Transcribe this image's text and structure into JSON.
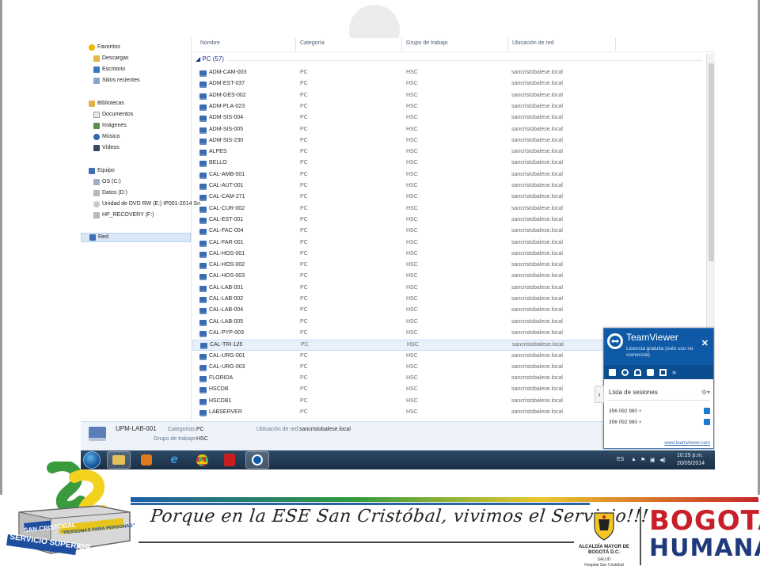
{
  "nav": {
    "favorites": "Favoritos",
    "downloads": "Descargas",
    "desktop": "Escritorio",
    "recent": "Sitios recientes",
    "libraries": "Bibliotecas",
    "documents": "Documentos",
    "images": "Imágenes",
    "music": "Música",
    "videos": "Vídeos",
    "computer": "Equipo",
    "drive_c": "OS (C:)",
    "drive_d": "Datos (D:)",
    "drive_e": "Unidad de DVD RW (E:) IP001-2014 Sn",
    "drive_f": "HP_RECOVERY (F:)",
    "network": "Red"
  },
  "columns": {
    "name": "Nombre",
    "category": "Categoría",
    "workgroup": "Grupo de trabajo",
    "location": "Ubicación de red"
  },
  "group_header": "PC (57)",
  "rows": [
    {
      "name": "ADM-CAM-003",
      "category": "PC",
      "group": "HSC",
      "location": "sancristobalese.local"
    },
    {
      "name": "ADM-EST-037",
      "category": "PC",
      "group": "HSC",
      "location": "sancristobalese.local"
    },
    {
      "name": "ADM-GES-002",
      "category": "PC",
      "group": "HSC",
      "location": "sancristobalese.local"
    },
    {
      "name": "ADM-PLA-023",
      "category": "PC",
      "group": "HSC",
      "location": "sancristobalese.local"
    },
    {
      "name": "ADM-SIS-004",
      "category": "PC",
      "group": "HSC",
      "location": "sancristobalese.local"
    },
    {
      "name": "ADM-SIS-005",
      "category": "PC",
      "group": "HSC",
      "location": "sancristobalese.local"
    },
    {
      "name": "ADM-SIS-230",
      "category": "PC",
      "group": "HSC",
      "location": "sancristobalese.local"
    },
    {
      "name": "ALPES",
      "category": "PC",
      "group": "HSC",
      "location": "sancristobalese.local"
    },
    {
      "name": "BELLO",
      "category": "PC",
      "group": "HSC",
      "location": "sancristobalese.local"
    },
    {
      "name": "CAL-AMB-001",
      "category": "PC",
      "group": "HSC",
      "location": "sancristobalese.local"
    },
    {
      "name": "CAL-AUT-001",
      "category": "PC",
      "group": "HSC",
      "location": "sancristobalese.local"
    },
    {
      "name": "CAL-CAM-271",
      "category": "PC",
      "group": "HSC",
      "location": "sancristobalese.local"
    },
    {
      "name": "CAL-CUR-002",
      "category": "PC",
      "group": "HSC",
      "location": "sancristobalese.local"
    },
    {
      "name": "CAL-EST-001",
      "category": "PC",
      "group": "HSC",
      "location": "sancristobalese.local"
    },
    {
      "name": "CAL-FAC-004",
      "category": "PC",
      "group": "HSC",
      "location": "sancristobalese.local"
    },
    {
      "name": "CAL-FAR-001",
      "category": "PC",
      "group": "HSC",
      "location": "sancristobalese.local"
    },
    {
      "name": "CAL-HOS-001",
      "category": "PC",
      "group": "HSC",
      "location": "sancristobalese.local"
    },
    {
      "name": "CAL-HOS-002",
      "category": "PC",
      "group": "HSC",
      "location": "sancristobalese.local"
    },
    {
      "name": "CAL-HOS-003",
      "category": "PC",
      "group": "HSC",
      "location": "sancristobalese.local"
    },
    {
      "name": "CAL-LAB-001",
      "category": "PC",
      "group": "HSC",
      "location": "sancristobalese.local"
    },
    {
      "name": "CAL-LAB-002",
      "category": "PC",
      "group": "HSC",
      "location": "sancristobalese.local"
    },
    {
      "name": "CAL-LAB-004",
      "category": "PC",
      "group": "HSC",
      "location": "sancristobalese.local"
    },
    {
      "name": "CAL-LAB-005",
      "category": "PC",
      "group": "HSC",
      "location": "sancristobalese.local"
    },
    {
      "name": "CAL-PYP-003",
      "category": "PC",
      "group": "HSC",
      "location": "sancristobalese.local"
    },
    {
      "name": "CAL-TRI-125",
      "category": "PC",
      "group": "HSC",
      "location": "sancristobalese.local"
    },
    {
      "name": "CAL-URG-001",
      "category": "PC",
      "group": "HSC",
      "location": "sancristobalese.local"
    },
    {
      "name": "CAL-URG-003",
      "category": "PC",
      "group": "HSC",
      "location": "sancristobalese.local"
    },
    {
      "name": "FLORIDA",
      "category": "PC",
      "group": "HSC",
      "location": "sancristobalese.local"
    },
    {
      "name": "HSCDB",
      "category": "PC",
      "group": "HSC",
      "location": "sancristobalese.local"
    },
    {
      "name": "HSCDB1",
      "category": "PC",
      "group": "HSC",
      "location": "sancristobalese.local"
    },
    {
      "name": "LABSERVER",
      "category": "PC",
      "group": "HSC",
      "location": "sancristobalese.local"
    }
  ],
  "selected_row": "CAL-TRI-125",
  "details": {
    "name": "UPM-LAB-001",
    "category_label": "Categorías:",
    "category_value": "PC",
    "group_label": "Grupo de trabajo:",
    "group_value": "HSC",
    "location_label": "Ubicación de red:",
    "location_value": "sancristobalese.local"
  },
  "taskbar": {
    "language": "ES",
    "time": "10:25 p.m.",
    "date": "20/05/2014"
  },
  "teamviewer": {
    "title": "TeamViewer",
    "subtitle": "Licencia gratuita (solo uso no comercial)",
    "sessions_title": "Lista de sesiones",
    "session1": "356 092 980",
    "session2": "356 092 980",
    "link": "www.teamviewer.com"
  },
  "banner": {
    "slogan": "Porque en la ESE San Cristóbal, vivimos el Servicio!!!",
    "logo_text_1": "SAN CRISTÓBAL",
    "logo_text_2": "SERVICIO SUPERIOR",
    "logo_text_3": "\"PERSONAS PARA PERSONAS\"",
    "alcaldia": "ALCALDÍA MAYOR DE BOGOTÁ D.C.",
    "salud": "SALUD",
    "hospital": "Hospital San Cristóbal",
    "bogota": "BOGOTÁ",
    "humana": "HUMANA"
  },
  "colors": {
    "teamviewer_blue": "#0e5aa7",
    "selection": "#d9e7f6",
    "taskbar": "#1a2e44"
  }
}
